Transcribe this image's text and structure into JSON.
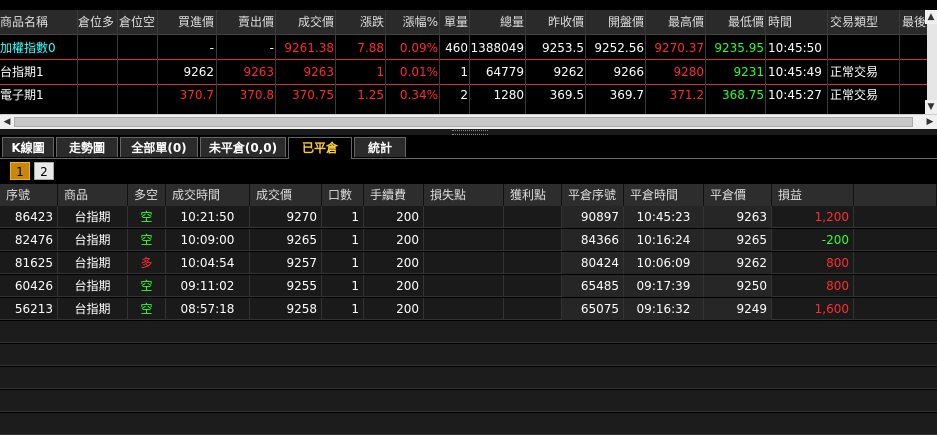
{
  "quote": {
    "headers": [
      "商品名稱",
      "倉位多",
      "倉位空",
      "買進價",
      "賣出價",
      "成交價",
      "漲跌",
      "漲幅%",
      "單量",
      "總量",
      "昨收價",
      "開盤價",
      "最高價",
      "最低價",
      "時間",
      "交易類型",
      "最後"
    ],
    "rows": [
      {
        "name": "加權指數0",
        "long": "",
        "short": "",
        "bid": "-",
        "ask": "-",
        "last": "9261.38",
        "change": "7.88",
        "pct": "0.09%",
        "vol": "460",
        "total": "1388049",
        "prev": "9253.5",
        "open": "9252.56",
        "high": "9270.37",
        "low": "9235.95",
        "time": "10:45:50",
        "type": ""
      },
      {
        "name": "台指期1",
        "long": "",
        "short": "",
        "bid": "9262",
        "ask": "9263",
        "last": "9263",
        "change": "1",
        "pct": "0.01%",
        "vol": "1",
        "total": "64779",
        "prev": "9262",
        "open": "9266",
        "high": "9280",
        "low": "9231",
        "time": "10:45:49",
        "type": "正常交易"
      },
      {
        "name": "電子期1",
        "long": "",
        "short": "",
        "bid": "370.7",
        "ask": "370.8",
        "last": "370.75",
        "change": "1.25",
        "pct": "0.34%",
        "vol": "2",
        "total": "1280",
        "prev": "369.5",
        "open": "369.7",
        "high": "371.2",
        "low": "368.75",
        "time": "10:45:27",
        "type": "正常交易"
      }
    ]
  },
  "tabs": [
    "K線圖",
    "走勢圖",
    "全部單(0)",
    "未平倉(0,0)",
    "已平倉",
    "統計"
  ],
  "active_tab": "已平倉",
  "pages": [
    "1",
    "2"
  ],
  "trades": {
    "headers": [
      "序號",
      "商品",
      "多空",
      "成交時間",
      "成交價",
      "口數",
      "手續費",
      "損失點",
      "獲利點",
      "平倉序號",
      "平倉時間",
      "平倉價",
      "損益"
    ],
    "rows": [
      {
        "id": "86423",
        "product": "台指期",
        "side": "空",
        "time": "10:21:50",
        "price": "9270",
        "qty": "1",
        "fee": "200",
        "loss": "",
        "gain": "",
        "close_id": "90897",
        "close_time": "10:45:23",
        "close_price": "9263",
        "pnl": "1,200",
        "pnl_color": "red"
      },
      {
        "id": "82476",
        "product": "台指期",
        "side": "空",
        "time": "10:09:00",
        "price": "9265",
        "qty": "1",
        "fee": "200",
        "loss": "",
        "gain": "",
        "close_id": "84366",
        "close_time": "10:16:24",
        "close_price": "9265",
        "pnl": "-200",
        "pnl_color": "green"
      },
      {
        "id": "81625",
        "product": "台指期",
        "side": "多",
        "time": "10:04:54",
        "price": "9257",
        "qty": "1",
        "fee": "200",
        "loss": "",
        "gain": "",
        "close_id": "80424",
        "close_time": "10:06:09",
        "close_price": "9262",
        "pnl": "800",
        "pnl_color": "red"
      },
      {
        "id": "60426",
        "product": "台指期",
        "side": "空",
        "time": "09:11:02",
        "price": "9255",
        "qty": "1",
        "fee": "200",
        "loss": "",
        "gain": "",
        "close_id": "65485",
        "close_time": "09:17:39",
        "close_price": "9250",
        "pnl": "800",
        "pnl_color": "red"
      },
      {
        "id": "56213",
        "product": "台指期",
        "side": "空",
        "time": "08:57:18",
        "price": "9258",
        "qty": "1",
        "fee": "200",
        "loss": "",
        "gain": "",
        "close_id": "65075",
        "close_time": "09:16:32",
        "close_price": "9249",
        "pnl": "1,600",
        "pnl_color": "red"
      }
    ]
  },
  "colors": {
    "up": "#ff2b2b",
    "down": "#2bff2b",
    "tab_active": "#ffcc33",
    "page_active": "#c8880a"
  }
}
